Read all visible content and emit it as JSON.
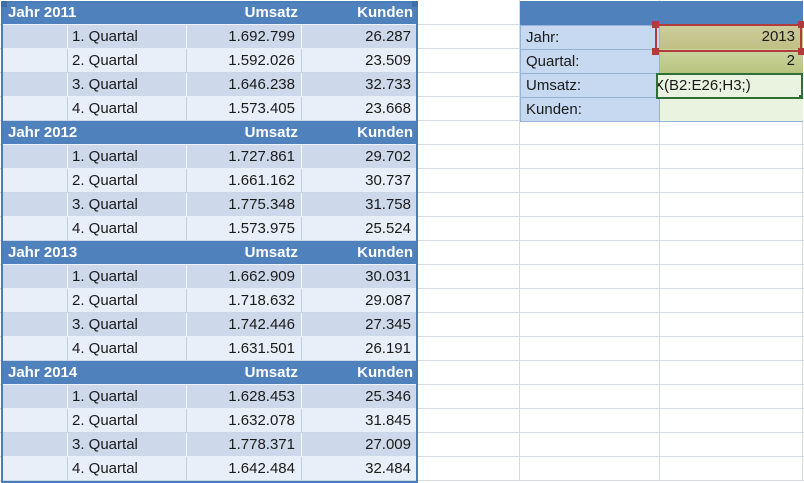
{
  "colors": {
    "header_blue": "#4f81bd",
    "band_dark": "#cdd9ea",
    "band_light": "#e9eff8",
    "label_cell_blue": "#c6d9f1",
    "input_khaki": "#c6c98f",
    "input_olive": "#bfca8a",
    "formula_cell_green": "#eaf3e0",
    "reference_red": "#b23c3c",
    "reference_green": "#2f6f35",
    "reference_blue": "#4a7cb8",
    "gridline": "#d6dbe2"
  },
  "table": {
    "blocks": [
      {
        "title": "Jahr 2011",
        "col_umsatz": "Umsatz",
        "col_kunden": "Kunden",
        "rows": [
          {
            "quartal": "1. Quartal",
            "umsatz": "1.692.799",
            "kunden": "26.287"
          },
          {
            "quartal": "2. Quartal",
            "umsatz": "1.592.026",
            "kunden": "23.509"
          },
          {
            "quartal": "3. Quartal",
            "umsatz": "1.646.238",
            "kunden": "32.733"
          },
          {
            "quartal": "4. Quartal",
            "umsatz": "1.573.405",
            "kunden": "23.668"
          }
        ]
      },
      {
        "title": "Jahr 2012",
        "col_umsatz": "Umsatz",
        "col_kunden": "Kunden",
        "rows": [
          {
            "quartal": "1. Quartal",
            "umsatz": "1.727.861",
            "kunden": "29.702"
          },
          {
            "quartal": "2. Quartal",
            "umsatz": "1.661.162",
            "kunden": "30.737"
          },
          {
            "quartal": "3. Quartal",
            "umsatz": "1.775.348",
            "kunden": "31.758"
          },
          {
            "quartal": "4. Quartal",
            "umsatz": "1.573.975",
            "kunden": "25.524"
          }
        ]
      },
      {
        "title": "Jahr 2013",
        "col_umsatz": "Umsatz",
        "col_kunden": "Kunden",
        "rows": [
          {
            "quartal": "1. Quartal",
            "umsatz": "1.662.909",
            "kunden": "30.031"
          },
          {
            "quartal": "2. Quartal",
            "umsatz": "1.718.632",
            "kunden": "29.087"
          },
          {
            "quartal": "3. Quartal",
            "umsatz": "1.742.446",
            "kunden": "27.345"
          },
          {
            "quartal": "4. Quartal",
            "umsatz": "1.631.501",
            "kunden": "26.191"
          }
        ]
      },
      {
        "title": "Jahr 2014",
        "col_umsatz": "Umsatz",
        "col_kunden": "Kunden",
        "rows": [
          {
            "quartal": "1. Quartal",
            "umsatz": "1.628.453",
            "kunden": "25.346"
          },
          {
            "quartal": "2. Quartal",
            "umsatz": "1.632.078",
            "kunden": "31.845"
          },
          {
            "quartal": "3. Quartal",
            "umsatz": "1.778.371",
            "kunden": "27.009"
          },
          {
            "quartal": "4. Quartal",
            "umsatz": "1.642.484",
            "kunden": "32.484"
          }
        ]
      }
    ]
  },
  "form": {
    "jahr_label": "Jahr:",
    "jahr_value": "2013",
    "quartal_label": "Quartal:",
    "quartal_value": "2",
    "umsatz_label": "Umsatz:",
    "umsatz_value": "X(B2:E26;H3;)",
    "kunden_label": "Kunden:",
    "kunden_value": ""
  }
}
